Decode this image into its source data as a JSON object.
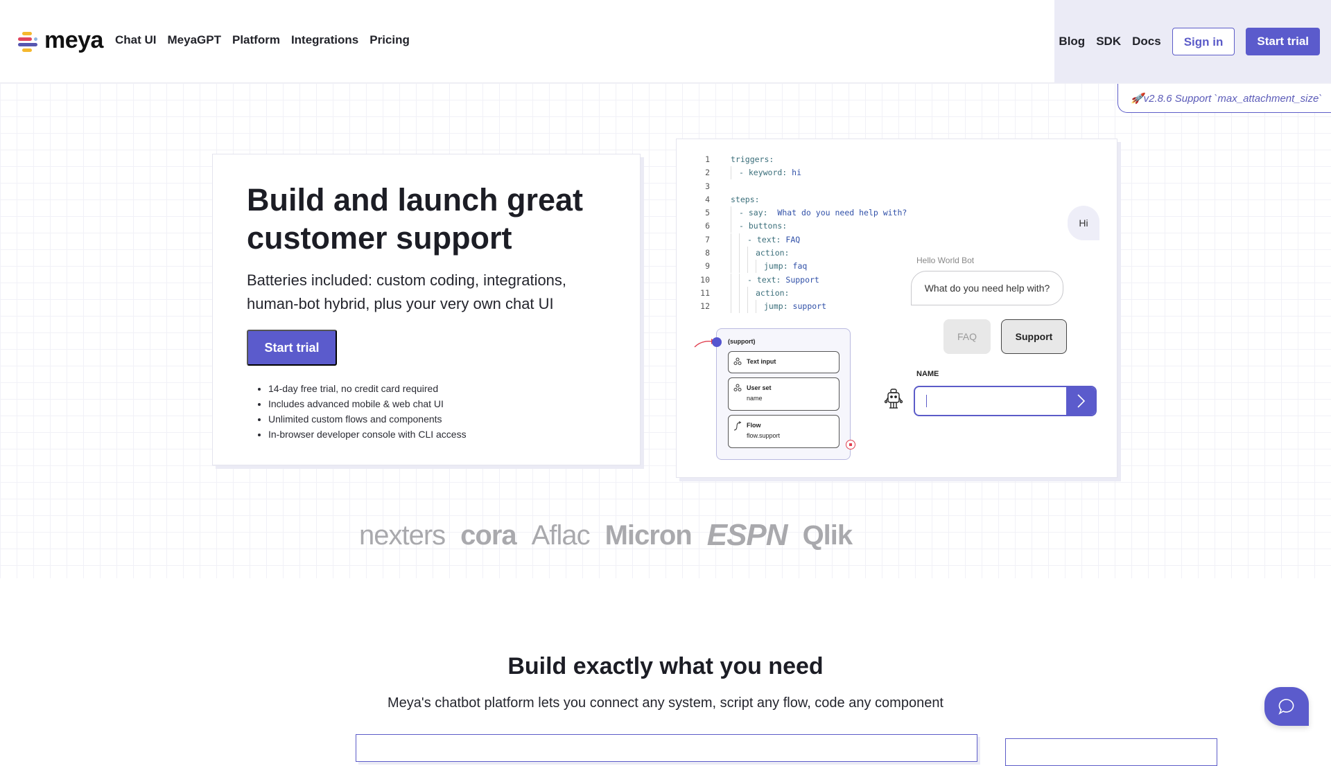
{
  "header": {
    "logo_text": "meya",
    "nav": [
      "Chat UI",
      "MeyaGPT",
      "Platform",
      "Integrations",
      "Pricing"
    ],
    "nav_right": [
      "Blog",
      "SDK",
      "Docs"
    ],
    "sign_in": "Sign in",
    "start_trial": "Start trial"
  },
  "release_banner": "🚀v2.8.6 Support `max_attachment_size`",
  "hero": {
    "title": "Build and launch great customer support",
    "subtitle": "Batteries included: custom coding, integrations, human-bot hybrid, plus your very own chat UI",
    "cta": "Start trial",
    "bullets": [
      "14-day free trial, no credit card required",
      "Includes advanced mobile & web chat UI",
      "Unlimited custom flows and components",
      "In-browser developer console with CLI access"
    ]
  },
  "demo": {
    "code_lines": [
      {
        "n": "1",
        "indent": 0,
        "key": "triggers:",
        "val": ""
      },
      {
        "n": "2",
        "indent": 1,
        "key": "- keyword:",
        "val": " hi"
      },
      {
        "n": "3",
        "indent": 0,
        "key": "",
        "val": ""
      },
      {
        "n": "4",
        "indent": 0,
        "key": "steps:",
        "val": ""
      },
      {
        "n": "5",
        "indent": 1,
        "key": "- say:",
        "val": "  What do you need help with?"
      },
      {
        "n": "6",
        "indent": 1,
        "key": "- buttons:",
        "val": ""
      },
      {
        "n": "7",
        "indent": 2,
        "key": "- text:",
        "val": " FAQ"
      },
      {
        "n": "8",
        "indent": 3,
        "key": "action:",
        "val": ""
      },
      {
        "n": "9",
        "indent": 4,
        "key": "jump:",
        "val": " faq"
      },
      {
        "n": "10",
        "indent": 2,
        "key": "- text:",
        "val": " Support"
      },
      {
        "n": "11",
        "indent": 3,
        "key": "action:",
        "val": ""
      },
      {
        "n": "12",
        "indent": 4,
        "key": "jump:",
        "val": " support"
      }
    ],
    "user_message": "Hi",
    "bot_name": "Hello World Bot",
    "bot_message": "What do you need help with?",
    "quick_replies": [
      "FAQ",
      "Support"
    ],
    "field_label": "NAME",
    "field_value": "",
    "flow": {
      "title": "(support)",
      "steps": [
        {
          "heading": "Text input",
          "sub": ""
        },
        {
          "heading": "User set",
          "sub": "name"
        },
        {
          "heading": "Flow",
          "sub": "flow.support"
        }
      ]
    }
  },
  "customer_logos": [
    "nexters",
    "cora",
    "Aflac",
    "Micron",
    "ESPN",
    "Qlik"
  ],
  "section": {
    "title": "Build exactly what you need",
    "subtitle": "Meya's chatbot platform lets you connect any system, script any flow, code any component"
  },
  "colors": {
    "accent": "#5b5bcc",
    "header_right_bg": "#ebebf6",
    "logo_gray": "#a9a9ad"
  }
}
